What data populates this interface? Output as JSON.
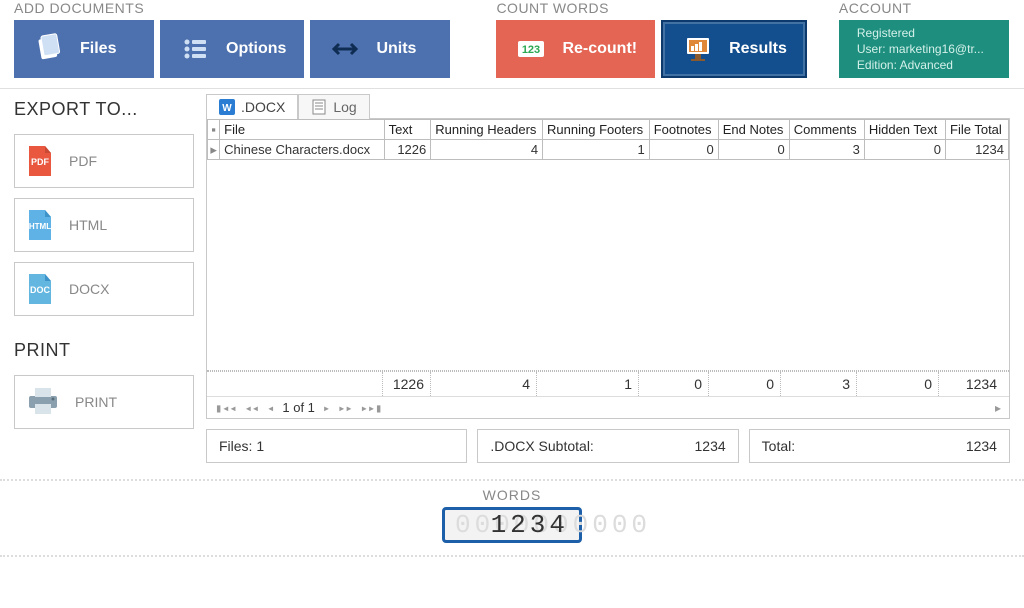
{
  "toolbar": {
    "add_documents_label": "ADD DOCUMENTS",
    "count_words_label": "COUNT WORDS",
    "account_label": "ACCOUNT",
    "files": "Files",
    "options": "Options",
    "units": "Units",
    "recount": "Re-count!",
    "results": "Results"
  },
  "account": {
    "line1": "Registered",
    "line2": "User: marketing16@tr...",
    "line3": "Edition: Advanced"
  },
  "export": {
    "title": "EXPORT TO...",
    "pdf": "PDF",
    "html": "HTML",
    "docx": "DOCX"
  },
  "print": {
    "title": "PRINT",
    "label": "PRINT"
  },
  "tabs": {
    "docx": ".DOCX",
    "log": "Log"
  },
  "table": {
    "columns": [
      "File",
      "Text",
      "Running Headers",
      "Running Footers",
      "Footnotes",
      "End Notes",
      "Comments",
      "Hidden Text",
      "File Total"
    ],
    "rows": [
      {
        "file": "Chinese Characters.docx",
        "text": 1226,
        "rh": 4,
        "rf": 1,
        "fn": 0,
        "en": 0,
        "cm": 3,
        "ht": 0,
        "total": 1234
      }
    ],
    "totals": {
      "text": 1226,
      "rh": 4,
      "rf": 1,
      "fn": 0,
      "en": 0,
      "cm": 3,
      "ht": 0,
      "total": 1234
    },
    "pager": "1 of 1"
  },
  "summary": {
    "files_label": "Files: 1",
    "subtotal_label": ".DOCX Subtotal:",
    "subtotal_value": "1234",
    "total_label": "Total:",
    "total_value": "1234"
  },
  "footer": {
    "words_label": "WORDS",
    "counter_ghost": "0000000000",
    "counter_value": "1234"
  },
  "colw": {
    "file": 162,
    "text": 46,
    "rh": 104,
    "rf": 100,
    "fn": 68,
    "en": 70,
    "cm": 74,
    "ht": 80,
    "total": 62
  }
}
